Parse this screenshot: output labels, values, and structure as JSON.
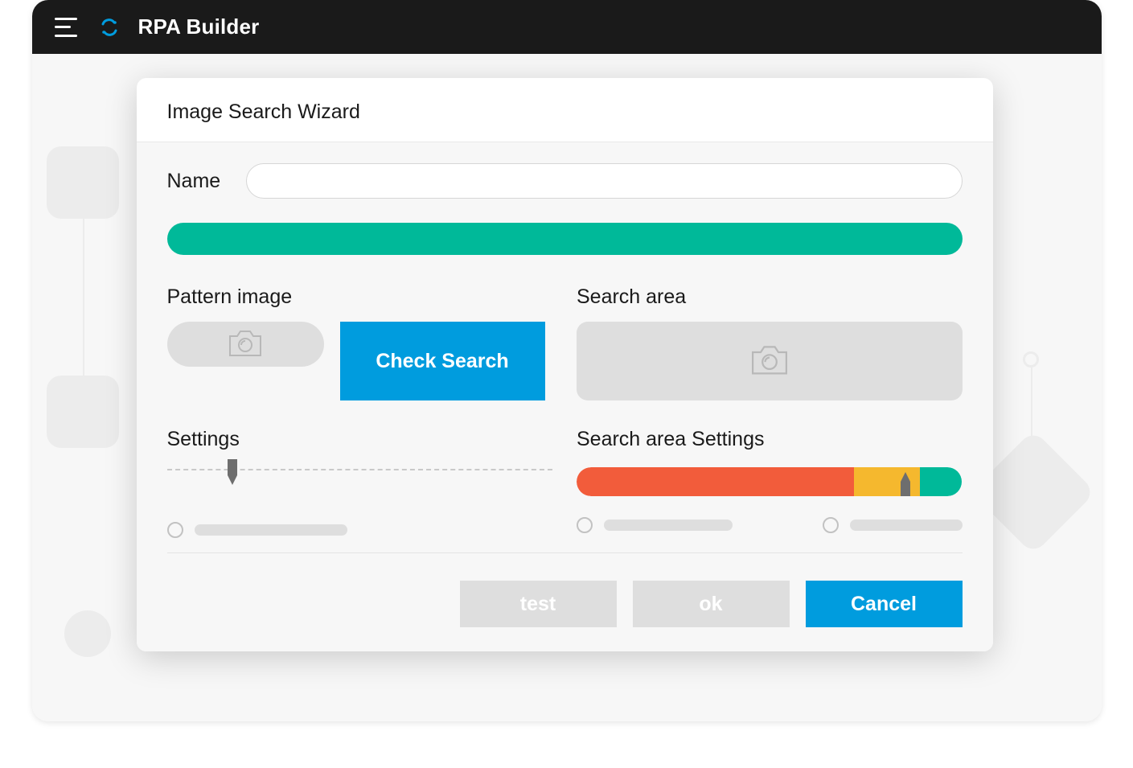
{
  "app": {
    "title": "RPA Builder"
  },
  "dialog": {
    "title": "Image Search Wizard",
    "name_label": "Name",
    "name_value": "",
    "pattern_image_label": "Pattern image",
    "check_search_label": "Check Search",
    "search_area_label": "Search area",
    "settings_label": "Settings",
    "search_area_settings_label": "Search area Settings",
    "buttons": {
      "test": "test",
      "ok": "ok",
      "cancel": "Cancel"
    }
  },
  "colors": {
    "accent_blue": "#009cde",
    "accent_green": "#00b999",
    "warn_yellow": "#f5b82e",
    "danger_red": "#f25c3b"
  }
}
